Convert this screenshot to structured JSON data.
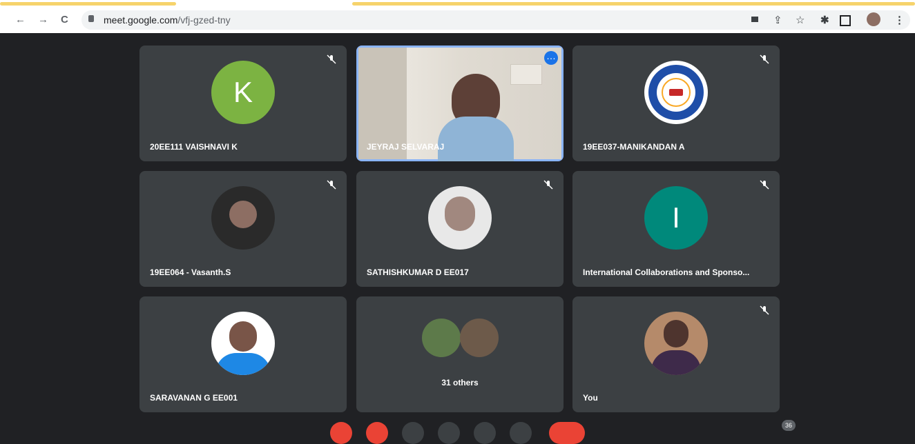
{
  "browser": {
    "url_host": "meet.google.com",
    "url_path": "/vfj-gzed-tny",
    "nav_icons": [
      "back-icon",
      "forward-icon",
      "reload-icon"
    ],
    "toolbar_icons": [
      "camera-icon",
      "share-icon",
      "star-icon",
      "extensions-icon",
      "sidepanel-icon",
      "profile-avatar",
      "menu-icon"
    ],
    "loading_color": "#f6d36b"
  },
  "meeting": {
    "tiles": [
      {
        "name": "20EE111 VAISHNAVI K",
        "type": "letter",
        "letter": "K",
        "color": "#7cb342",
        "muted": true
      },
      {
        "name": "JEYRAJ SELVARAJ",
        "type": "video",
        "muted": false,
        "active": true
      },
      {
        "name": "19EE037-MANIKANDAN A",
        "type": "logo",
        "muted": true
      },
      {
        "name": "19EE064 - Vasanth.S",
        "type": "photo",
        "color": "#2a2a2a",
        "muted": true
      },
      {
        "name": "SATHISHKUMAR D EE017",
        "type": "photo",
        "color": "#e8e8e8",
        "muted": true
      },
      {
        "name": "International Collaborations and Sponso...",
        "type": "letter",
        "letter": "I",
        "color": "#00897b",
        "muted": true
      },
      {
        "name": "SARAVANAN G EE001",
        "type": "photo",
        "color": "#ffffff",
        "muted": false
      },
      {
        "name": "31 others",
        "type": "others",
        "muted": false
      },
      {
        "name": "You",
        "type": "photo",
        "color": "#b58a6a",
        "muted": true
      }
    ],
    "participant_count": "36",
    "accent": "#8ab4f8"
  }
}
